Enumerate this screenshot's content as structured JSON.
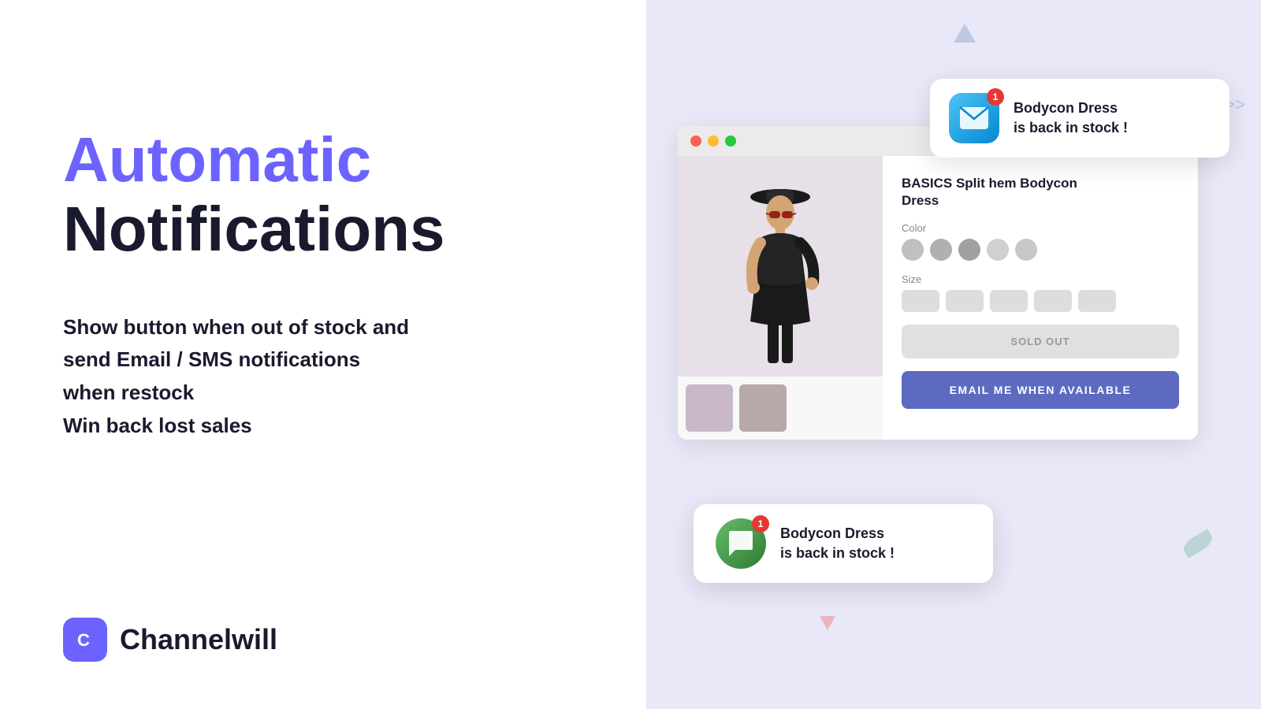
{
  "left": {
    "headline_line1": "Automatic",
    "headline_line2": "Notifications",
    "description_line1": "Show button when out of stock and",
    "description_line2": "send Email / SMS notifications",
    "description_line3": "when restock",
    "description_line4": "Win back lost sales",
    "brand_name": "Channelwill"
  },
  "right": {
    "email_notification": {
      "title_line1": "Bodycon Dress",
      "title_line2": "is back in stock !",
      "badge": "1"
    },
    "browser": {
      "product_title_line1": "BASICS Split hem Bodycon",
      "product_title_line2": "Dress",
      "color_label": "Color",
      "size_label": "Size",
      "sold_out_label": "SOLD OUT",
      "email_me_label": "EMAIL ME WHEN AVAILABLE"
    },
    "sms_notification": {
      "title_line1": "Bodycon Dress",
      "title_line2": "is back in stock !",
      "badge": "1"
    }
  },
  "colors": {
    "primary_purple": "#6c63ff",
    "button_blue": "#5c6bc0",
    "dark_text": "#1a1a2e",
    "right_bg": "#e8e8f8"
  }
}
